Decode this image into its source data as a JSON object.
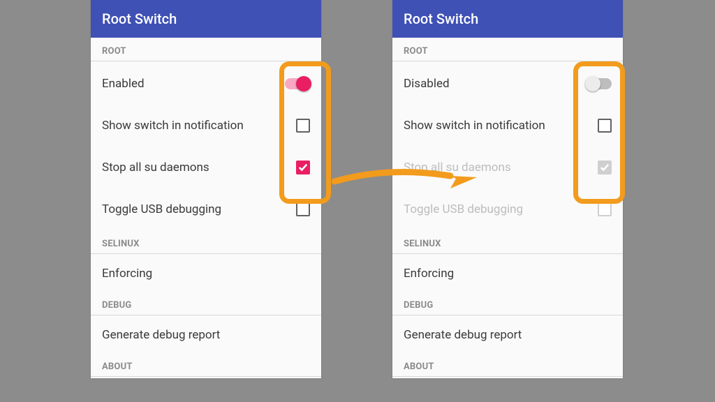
{
  "colors": {
    "appbar": "#3f51b5",
    "accentPink": "#e91e63",
    "highlight": "#f29b1d"
  },
  "left": {
    "title": "Root Switch",
    "sections": {
      "root": "ROOT",
      "selinux": "SELINUX",
      "debug": "DEBUG",
      "about": "ABOUT"
    },
    "rows": {
      "enabled": {
        "label": "Enabled",
        "switch_on": true
      },
      "showSwitch": {
        "label": "Show switch in notification",
        "checked": false
      },
      "stopSu": {
        "label": "Stop all su daemons",
        "checked": true
      },
      "usb": {
        "label": "Toggle USB debugging",
        "checked": false
      },
      "enforcing": {
        "label": "Enforcing"
      },
      "debugReport": {
        "label": "Generate debug report"
      }
    }
  },
  "right": {
    "title": "Root Switch",
    "sections": {
      "root": "ROOT",
      "selinux": "SELINUX",
      "debug": "DEBUG",
      "about": "ABOUT"
    },
    "rows": {
      "enabled": {
        "label": "Disabled",
        "switch_on": false
      },
      "showSwitch": {
        "label": "Show switch in notification",
        "checked": false
      },
      "stopSu": {
        "label": "Stop all su daemons",
        "checked": true,
        "disabled": true
      },
      "usb": {
        "label": "Toggle USB debugging",
        "checked": false,
        "disabled": true
      },
      "enforcing": {
        "label": "Enforcing"
      },
      "debugReport": {
        "label": "Generate debug report"
      }
    }
  }
}
